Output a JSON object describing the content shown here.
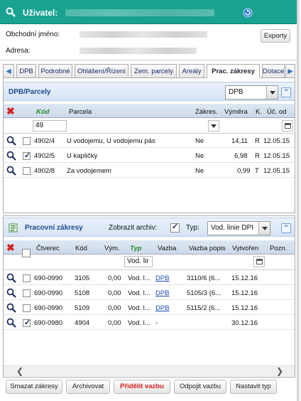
{
  "header": {
    "title": "Uživatel:"
  },
  "info": {
    "business_name_label": "Obchodní jméno:",
    "address_label": "Adresa:",
    "exports_label": "Exporty"
  },
  "tabs": [
    "DPB",
    "Podrobné",
    "Ohlášení/Řízení",
    "Zem. parcely",
    "Areály",
    "Prac. zákresy",
    "Dotace"
  ],
  "dpb": {
    "title": "DPB/Parcely",
    "select_value": "DPB",
    "columns": {
      "kod": "Kód",
      "parcela": "Parcela",
      "zakres": "Zákres.",
      "vymera": "Výměra",
      "k": "K.",
      "uc_od": "Úč. od"
    },
    "filter_kod": "49",
    "rows": [
      {
        "kod": "4902/4",
        "parcela": "U vodojemu, U vodojemu pás",
        "zakres": "Ne",
        "vymera": "14,11",
        "k": "R",
        "uc_od": "12.05.15",
        "checked": false
      },
      {
        "kod": "4902/5",
        "parcela": "U kapličky",
        "zakres": "Ne",
        "vymera": "6,98",
        "k": "R",
        "uc_od": "12.05.15",
        "checked": true
      },
      {
        "kod": "4902/8",
        "parcela": "Za vodojemem",
        "zakres": "Ne",
        "vymera": "0,99",
        "k": "T",
        "uc_od": "12.05.15",
        "checked": false
      }
    ]
  },
  "zakresy": {
    "title": "Pracovní zákresy",
    "archive_label": "Zobrazit archiv:",
    "type_label": "Typ:",
    "type_value": "Vod. linie DPI",
    "columns": {
      "ctverec": "Čtverec",
      "kod": "Kód",
      "vym": "Vým.",
      "typ": "Typ",
      "vazba": "Vazba",
      "vazba_popis": "Vazba popis",
      "vytvoren": "Vytvořen",
      "pozn": "Pozn."
    },
    "filter_typ": "Vod. lir",
    "rows": [
      {
        "ctverec": "690-0990",
        "kod": "3105",
        "vym": "0,00",
        "typ": "Vod. l...",
        "vazba": "DPB",
        "vazba_popis": "3110/6 (6...",
        "vytvoren": "15.12.16",
        "checked": false
      },
      {
        "ctverec": "690-0990",
        "kod": "5108",
        "vym": "0,00",
        "typ": "Vod. l...",
        "vazba": "DPB",
        "vazba_popis": "5105/3 (6...",
        "vytvoren": "15.12.16",
        "checked": false
      },
      {
        "ctverec": "690-0990",
        "kod": "5109",
        "vym": "0,00",
        "typ": "Vod. l...",
        "vazba": "DPB",
        "vazba_popis": "5115/2 (6...",
        "vytvoren": "15.12.16",
        "checked": false
      },
      {
        "ctverec": "690-0980",
        "kod": "4904",
        "vym": "0,00",
        "typ": "Vod. l...",
        "vazba": "-",
        "vazba_popis": "",
        "vytvoren": "30.12.16",
        "checked": true
      }
    ]
  },
  "buttons": {
    "delete": "Smazat zákresy",
    "archive": "Archivovat",
    "assign": "Přidělit vazbu",
    "detach": "Odpojit vazbu",
    "set_type": "Nastavit typ"
  },
  "colors": {
    "header": "#1aa291",
    "accent_red": "#d42020",
    "typ_green": "#2a8a2a",
    "link": "#1f4fb5"
  }
}
